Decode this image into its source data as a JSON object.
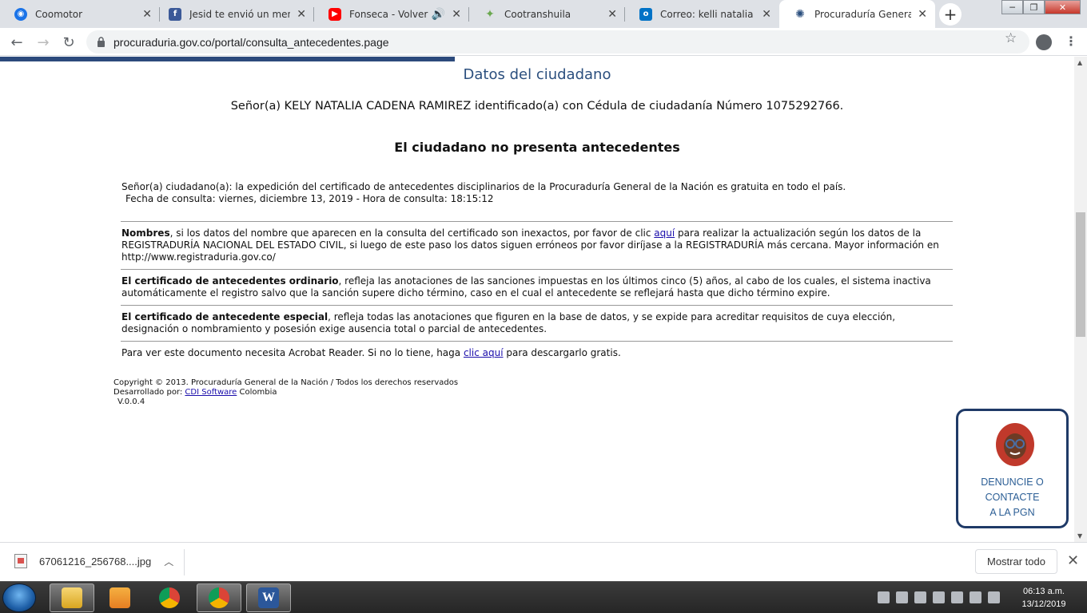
{
  "browser": {
    "tabs": [
      {
        "title": "Coomotor",
        "icon": "coomotor-icon",
        "color": "#1a73e8"
      },
      {
        "title": "Jesid te envió un mensaje",
        "icon": "facebook-icon",
        "color": "#3b5998"
      },
      {
        "title": "Fonseca - Volver a V",
        "icon": "youtube-icon",
        "color": "#ff0000"
      },
      {
        "title": "Cootranshuila",
        "icon": "hummingbird-icon",
        "color": "#6aa84f"
      },
      {
        "title": "Correo: kelli natalia cade",
        "icon": "outlook-icon",
        "color": "#0072c6"
      },
      {
        "title": "Procuraduría General de",
        "icon": "procuraduria-icon",
        "color": "#2b4f7e"
      }
    ],
    "url": "procuraduria.gov.co/portal/consulta_antecedentes.page"
  },
  "page": {
    "section_title": "Datos del ciudadano",
    "citizen_line": "Señor(a)  KELY NATALIA CADENA RAMIREZ identificado(a) con Cédula de ciudadanía Número 1075292766.",
    "verdict": "El ciudadano no presenta antecedentes",
    "notice_line1": "Señor(a) ciudadano(a): la expedición del certificado de antecedentes disciplinarios de la Procuraduría General de la Nación es gratuita en todo el país.",
    "notice_line2": "Fecha de consulta: viernes, diciembre 13, 2019 - Hora de consulta: 18:15:12",
    "nombres": {
      "bold": "Nombres",
      "text_before_link": ", si los datos del nombre que aparecen en la consulta del certificado son inexactos, por favor de clic ",
      "link": "aquí",
      "text_after_link": " para realizar la actualización según los datos de la REGISTRADURÍA NACIONAL DEL ESTADO CIVIL, si luego de este paso los datos siguen erróneos por favor diríjase a la REGISTRADURÍA más cercana. Mayor información en http://www.registraduria.gov.co/"
    },
    "ordinario": {
      "bold": "El certificado de antecedentes ordinario",
      "text": ", refleja las anotaciones de las sanciones impuestas en los últimos cinco (5) años, al cabo de los cuales, el sistema inactiva automáticamente el registro salvo que la sanción supere dicho término, caso en el cual el antecedente se reflejará hasta que dicho término expire."
    },
    "especial": {
      "bold": "El certificado de antecedente especial",
      "text": ", refleja todas las anotaciones que figuren en la base de datos, y se expide para acreditar requisitos de cuya elección, designación o nombramiento y posesión exige ausencia total o parcial de antecedentes."
    },
    "acrobat": {
      "text_before_link": "Para ver este documento necesita Acrobat Reader. Si no lo tiene, haga ",
      "link": "clic aquí",
      "text_after_link": " para descargarlo gratis."
    },
    "footer": {
      "copyright": "Copyright © 2013. Procuraduría General de la Nación / Todos los derechos reservados",
      "dev_prefix": "Desarrollado por: ",
      "dev_link": "CDI Software",
      "dev_suffix": " Colombia",
      "version": "V.0.0.4"
    }
  },
  "widget": {
    "line1": "DENUNCIE O",
    "line2": "CONTACTE",
    "line3": "A LA PGN"
  },
  "downloads": {
    "filename": "67061216_256768....jpg",
    "show_all": "Mostrar todo"
  },
  "taskbar": {
    "time": "06:13 a.m.",
    "date": "13/12/2019",
    "apps": [
      "explorer-icon",
      "media-player-icon",
      "chrome-icon",
      "chrome-active-icon",
      "word-icon"
    ]
  }
}
